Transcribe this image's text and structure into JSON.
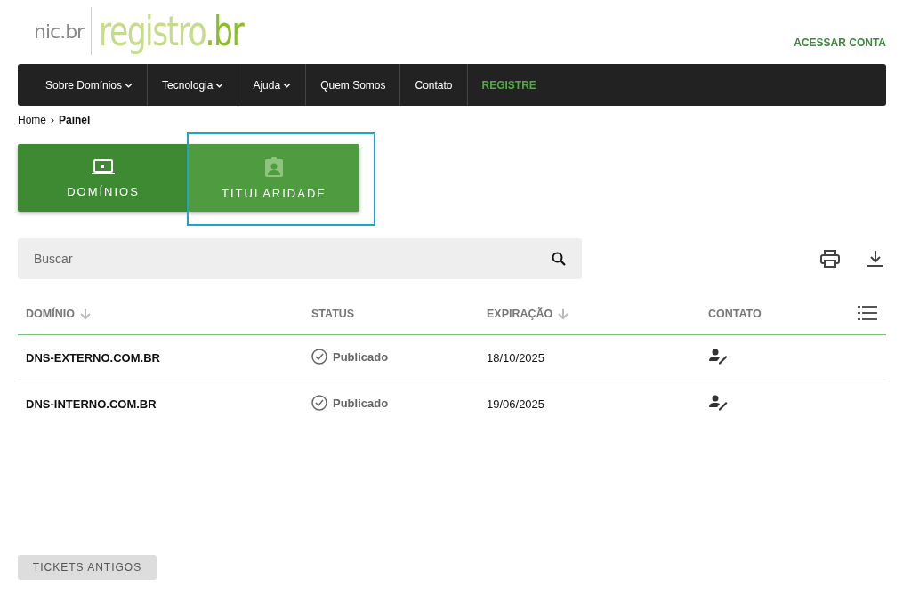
{
  "logo": {
    "org": "nic.br",
    "name": "registro",
    "suffix": ".br"
  },
  "account_link": "ACESSAR CONTA",
  "nav": [
    {
      "label": "Sobre Domínios",
      "dropdown": true,
      "highlight": false
    },
    {
      "label": "Tecnologia",
      "dropdown": true,
      "highlight": false
    },
    {
      "label": "Ajuda",
      "dropdown": true,
      "highlight": false
    },
    {
      "label": "Quem Somos",
      "dropdown": false,
      "highlight": false
    },
    {
      "label": "Contato",
      "dropdown": false,
      "highlight": false
    },
    {
      "label": "REGISTRE",
      "dropdown": false,
      "highlight": true
    }
  ],
  "breadcrumb": [
    {
      "label": "Home",
      "current": false
    },
    {
      "label": "Painel",
      "current": true
    }
  ],
  "breadcrumb_separator": "›",
  "tabs": [
    {
      "label": "DOMÍNIOS",
      "kind": "laptop",
      "selected": true,
      "focused": false
    },
    {
      "label": "TITULARIDADE",
      "kind": "badge",
      "selected": false,
      "focused": true
    }
  ],
  "search": {
    "placeholder": "Buscar"
  },
  "table": {
    "columns": [
      {
        "label": "DOMÍNIO",
        "sortable": true
      },
      {
        "label": "STATUS",
        "sortable": false
      },
      {
        "label": "EXPIRAÇÃO",
        "sortable": true
      },
      {
        "label": "CONTATO",
        "sortable": false
      }
    ],
    "rows": [
      {
        "domain": "DNS-EXTERNO.COM.BR",
        "status": "Publicado",
        "expiration": "18/10/2025"
      },
      {
        "domain": "DNS-INTERNO.COM.BR",
        "status": "Publicado",
        "expiration": "19/06/2025"
      }
    ]
  },
  "old_tickets_button": "TICKETS ANTIGOS"
}
